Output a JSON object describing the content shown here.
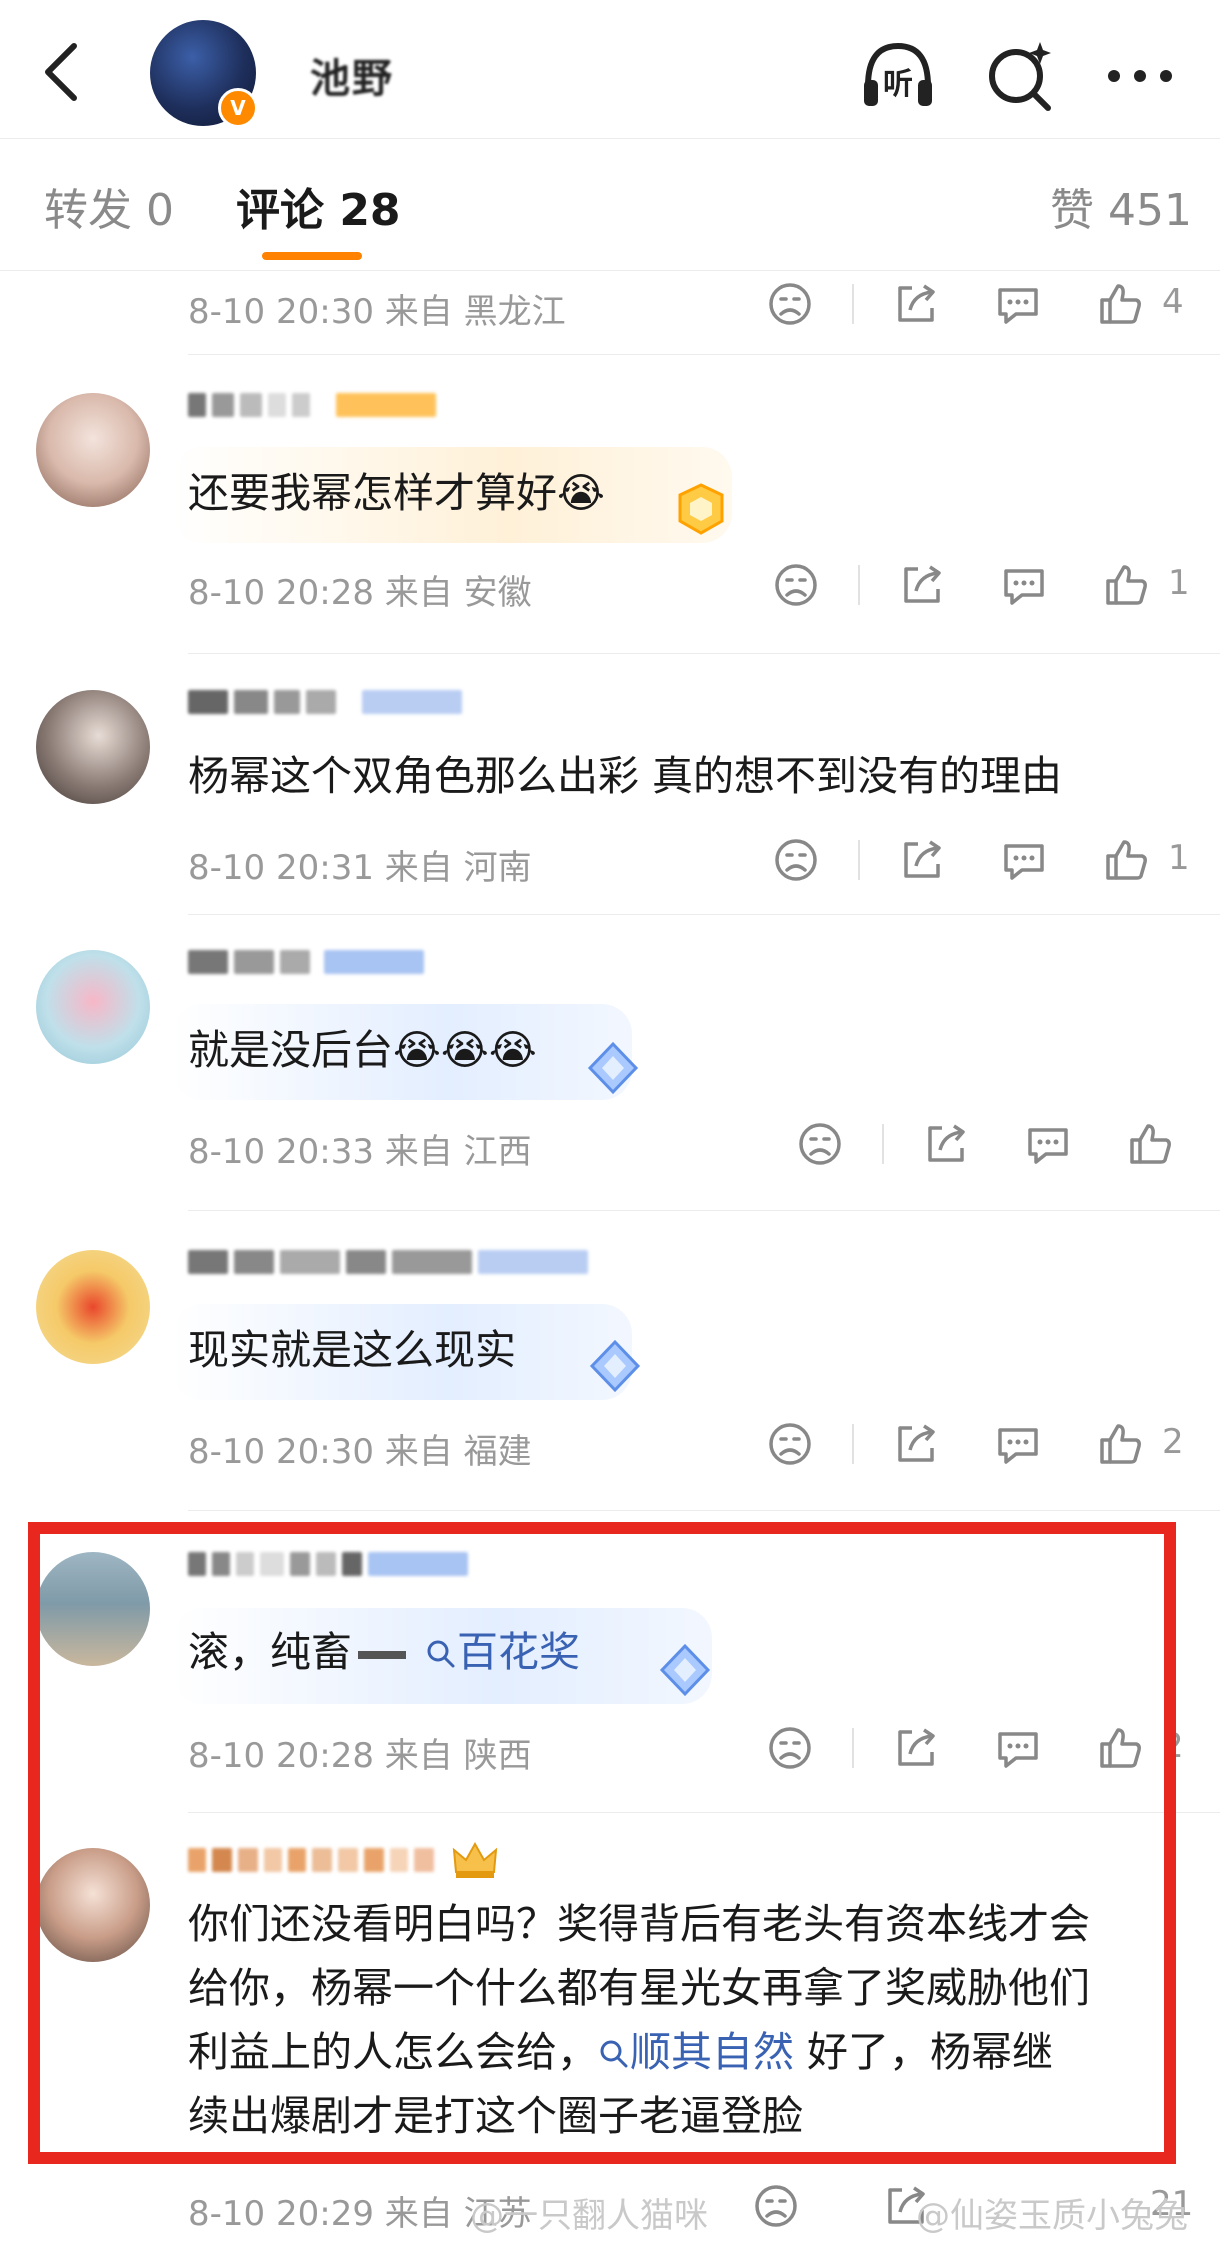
{
  "header": {
    "back_label": "返回",
    "user_name": "池野",
    "verified_badge": "V",
    "listen_label": "听",
    "icons": [
      "back-icon",
      "listen-icon",
      "ai-search-icon",
      "more-icon"
    ]
  },
  "tabs": [
    {
      "label": "转发 0"
    },
    {
      "label": "评论 28"
    },
    {
      "label": "赞 451"
    }
  ],
  "top_row": {
    "meta": "8-10 20:30 来自 黑龙江",
    "likes": "4"
  },
  "comments": [
    {
      "text": "还要我幂怎样才算好😭",
      "meta": "8-10 20:28 来自 安徽",
      "likes": "1"
    },
    {
      "text": "杨幂这个双角色那么出彩  真的想不到没有的理由",
      "meta": "8-10 20:31 来自 河南",
      "likes": "1"
    },
    {
      "text": "就是没后台😭😭😭",
      "meta": "8-10 20:33 来自 江西",
      "likes": ""
    },
    {
      "text": "现实就是这么现实",
      "meta": "8-10 20:30 来自 福建",
      "likes": "2"
    },
    {
      "text_prefix": "滚，纯畜",
      "link": "百花奖",
      "meta": "8-10 20:28 来自 陕西",
      "likes": "2"
    },
    {
      "lines": [
        "你们还没看明白吗？奖得背后有老头有资本线才会",
        "给你，杨幂一个什么都有星光女再拿了奖威胁他们",
        "利益上的人怎么会给，",
        "续出爆剧才是打这个圈子老逼登脸"
      ],
      "link": "顺其自然",
      "after_link": " 好了，杨幂继",
      "meta": "8-10 20:29 来自 江苏",
      "likes": "21"
    }
  ],
  "watermark": {
    "left": "@一只翻人猫咪",
    "right": "@仙姿玉质小兔兔"
  },
  "colors": {
    "accent": "#ff8200",
    "highlight": "#e8281e",
    "link": "#3a62b3"
  }
}
